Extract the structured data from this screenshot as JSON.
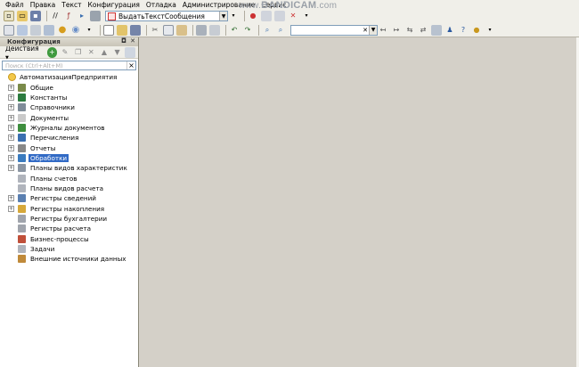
{
  "menu": [
    "Файл",
    "Правка",
    "Текст",
    "Конфигурация",
    "Отладка",
    "Администрирование",
    "Сервис"
  ],
  "watermark": {
    "prefix": "www.",
    "brand": "BANDICAM",
    "suffix": ".com"
  },
  "toolbar1": {
    "procedure_combo": "ВыдатьТекстСообщения",
    "icons": [
      "new-icon",
      "open-icon",
      "save-icon",
      "print-icon",
      "procedure-icon",
      "bookmark-icon"
    ]
  },
  "toolbar2": {
    "search_value": "",
    "icons": [
      "copy-icon",
      "paste-icon",
      "cut-icon",
      "undo-icon",
      "redo-icon",
      "find-icon"
    ]
  },
  "config_panel": {
    "title": "Конфигурация",
    "actions_label": "Действия",
    "search_placeholder": "Поиск (Ctrl+Alt+M)",
    "clear_glyph": "×"
  },
  "tree": {
    "root": "АвтоматизацияПредприятия",
    "items": [
      {
        "label": "Общие",
        "expandable": true,
        "icon": "general-icon",
        "color": "#7a8a4a"
      },
      {
        "label": "Константы",
        "expandable": true,
        "icon": "constants-icon",
        "color": "#2c7b3f"
      },
      {
        "label": "Справочники",
        "expandable": true,
        "icon": "catalogs-icon",
        "color": "#7f8c99"
      },
      {
        "label": "Документы",
        "expandable": true,
        "icon": "documents-icon",
        "color": "#c9c9c9"
      },
      {
        "label": "Журналы документов",
        "expandable": true,
        "icon": "journals-icon",
        "color": "#3e8e3e"
      },
      {
        "label": "Перечисления",
        "expandable": true,
        "icon": "enums-icon",
        "color": "#3a6fb0"
      },
      {
        "label": "Отчеты",
        "expandable": true,
        "icon": "reports-icon",
        "color": "#888888"
      },
      {
        "label": "Обработки",
        "expandable": true,
        "icon": "dataprocessors-icon",
        "color": "#3a7bbf",
        "selected": true
      },
      {
        "label": "Планы видов характеристик",
        "expandable": true,
        "icon": "charts-of-characteristic-types-icon",
        "color": "#8c96a3"
      },
      {
        "label": "Планы счетов",
        "expandable": false,
        "icon": "charts-of-accounts-icon",
        "color": "#b0b4bc"
      },
      {
        "label": "Планы видов расчета",
        "expandable": false,
        "icon": "charts-of-calculation-types-icon",
        "color": "#b0b4bc"
      },
      {
        "label": "Регистры сведений",
        "expandable": true,
        "icon": "information-registers-icon",
        "color": "#5a7fb0"
      },
      {
        "label": "Регистры накопления",
        "expandable": true,
        "icon": "accumulation-registers-icon",
        "color": "#d6a83a"
      },
      {
        "label": "Регистры бухгалтерии",
        "expandable": false,
        "icon": "accounting-registers-icon",
        "color": "#a0a4ac"
      },
      {
        "label": "Регистры расчета",
        "expandable": false,
        "icon": "calculation-registers-icon",
        "color": "#a0a4ac"
      },
      {
        "label": "Бизнес-процессы",
        "expandable": false,
        "icon": "business-processes-icon",
        "color": "#c0503a"
      },
      {
        "label": "Задачи",
        "expandable": false,
        "icon": "tasks-icon",
        "color": "#b0b4bc"
      },
      {
        "label": "Внешние источники данных",
        "expandable": false,
        "icon": "external-data-sources-icon",
        "color": "#c08a3a"
      }
    ]
  }
}
